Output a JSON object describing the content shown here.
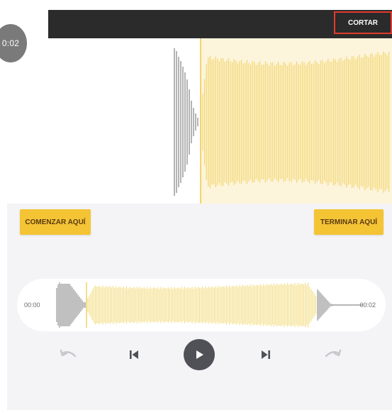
{
  "timer": {
    "value": "0:02"
  },
  "toolbar": {
    "cut_label": "CORTAR"
  },
  "editor": {
    "start_button_label": "COMENZAR AQUÍ",
    "end_button_label": "TERMINAR AQUÍ"
  },
  "track": {
    "start_time": "00:00",
    "end_time": "00:02"
  },
  "colors": {
    "accent": "#f4c435",
    "selection_fill": "#fdf4dc",
    "waveform_selected": "#f2d873",
    "waveform_unselected": "#8c8c8c",
    "highlight_border": "#e23a2c",
    "topbar": "#2b2b2b"
  },
  "icons": {
    "undo": "undo-arrow-icon",
    "previous": "skip-previous-icon",
    "play": "play-icon",
    "next": "skip-next-icon",
    "redo": "redo-arrow-icon"
  }
}
